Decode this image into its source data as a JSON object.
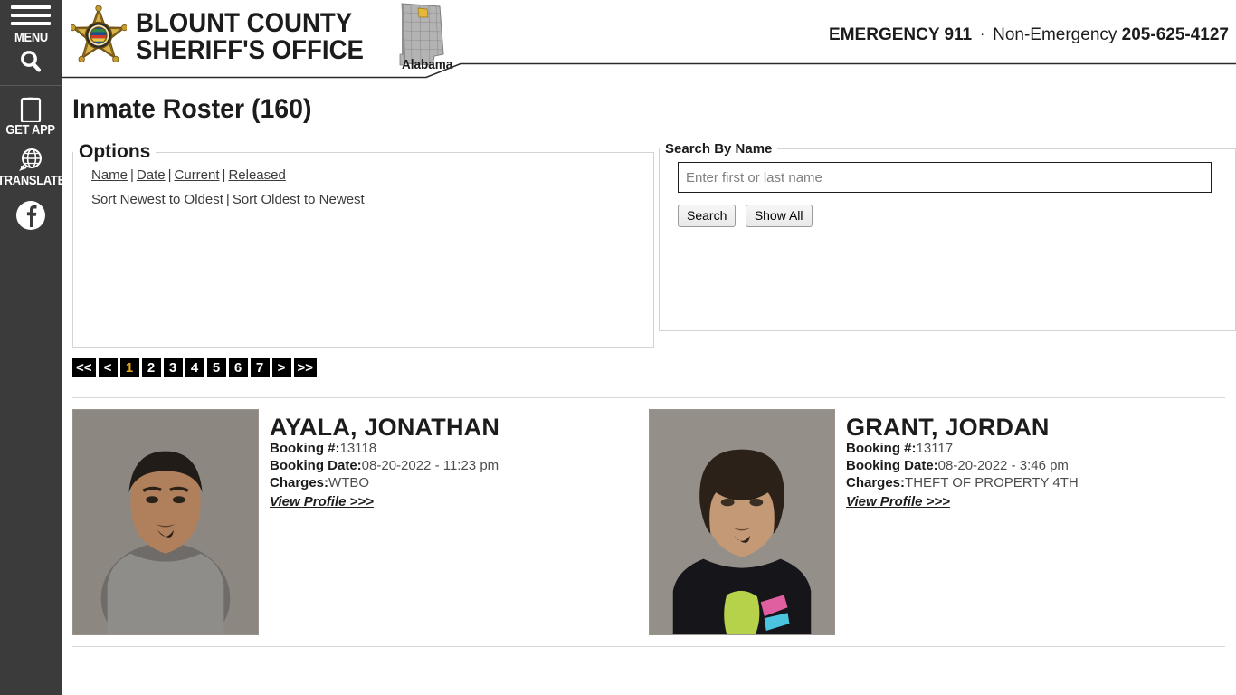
{
  "colors": {
    "rail_bg": "#3b3b3b",
    "accent_gold": "#e5a919",
    "text_dark": "#1c1c1c",
    "pager_bg": "#000000"
  },
  "sidebar": {
    "menu_label": "MENU",
    "search_icon_name": "search-icon",
    "items": [
      {
        "label": "GET APP",
        "icon": "mobile-phone-icon"
      },
      {
        "label": "TRANSLATE",
        "icon": "globe-speech-bubble-icon"
      },
      {
        "label": "Facebook",
        "icon": "facebook-icon"
      }
    ]
  },
  "header": {
    "badge_icon": "sheriff-star-badge-icon",
    "title_line1": "BLOUNT COUNTY",
    "title_line2": "SHERIFF'S OFFICE",
    "map_label": "Alabama",
    "map_icon": "alabama-state-map-icon",
    "emergency_label": "EMERGENCY 911",
    "separator": "·",
    "non_emergency_label": "Non-Emergency",
    "non_emergency_number": "205-625-4127"
  },
  "main": {
    "page_title": "Inmate Roster (160)",
    "options": {
      "legend": "Options",
      "row1": [
        {
          "label": "Name"
        },
        {
          "label": "Date"
        },
        {
          "label": "Current"
        },
        {
          "label": "Released"
        }
      ],
      "row2": [
        {
          "label": "Sort Newest to Oldest"
        },
        {
          "label": "Sort Oldest to Newest"
        }
      ],
      "separator": "|"
    },
    "search": {
      "legend": "Search By Name",
      "input_value": "",
      "placeholder": "Enter first or last name",
      "search_button": "Search",
      "show_all_button": "Show All"
    },
    "pagination": {
      "first": "<<",
      "prev": "<",
      "pages": [
        "1",
        "2",
        "3",
        "4",
        "5",
        "6",
        "7"
      ],
      "active_page": "1",
      "next": ">",
      "last": ">>"
    },
    "labels": {
      "booking_number": "Booking #:",
      "booking_date": "Booking Date:",
      "charges": "Charges:",
      "view_profile": "View Profile >>>"
    },
    "inmates": [
      {
        "name": "AYALA, JONATHAN",
        "booking_number": "13118",
        "booking_date": "08-20-2022 - 11:23 pm",
        "charges": "WTBO",
        "mugshot": "mugshot-photo"
      },
      {
        "name": "GRANT, JORDAN",
        "booking_number": "13117",
        "booking_date": "08-20-2022 - 3:46 pm",
        "charges": "THEFT OF PROPERTY 4TH",
        "mugshot": "mugshot-photo"
      }
    ]
  }
}
